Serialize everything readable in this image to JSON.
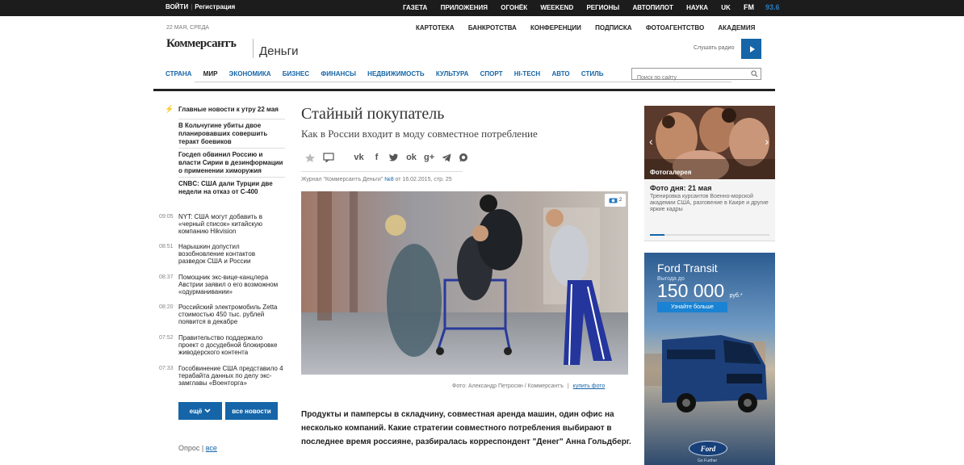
{
  "topbar": {
    "login": "ВОЙТИ",
    "register": "Регистрация",
    "links": [
      "ГАЗЕТА",
      "ПРИЛОЖЕНИЯ",
      "ОГОНЁК",
      "WEEKEND",
      "РЕГИОНЫ",
      "АВТОПИЛОТ",
      "НАУКА",
      "UK"
    ],
    "fm": "FM",
    "fm_freq": "93.6"
  },
  "header": {
    "date": "22 МАЯ, СРЕДА",
    "secondary_nav": [
      "КАРТОТЕКА",
      "БАНКРОТСТВА",
      "КОНФЕРЕНЦИИ",
      "ПОДПИСКА",
      "ФОТОАГЕНТСТВО",
      "АКАДЕМИЯ"
    ],
    "logo": "Коммерсантъ",
    "section": "Деньги",
    "radio_label": "Слушать радио"
  },
  "main_nav": {
    "items": [
      "СТРАНА",
      "МИР",
      "ЭКОНОМИКА",
      "БИЗНЕС",
      "ФИНАНСЫ",
      "НЕДВИЖИМОСТЬ",
      "КУЛЬТУРА",
      "СПОРТ",
      "HI-TECH",
      "АВТО",
      "СТИЛЬ"
    ],
    "active": "МИР",
    "search_placeholder": "Поиск по сайту"
  },
  "left": {
    "lead_heading": "Главные новости к утру 22 мая",
    "lead_items": [
      "В Кольчугине убиты двое планировавших совершить теракт боевиков",
      "Госдеп обвинил Россию и власти Сирии в дезинформации о применении химоружия",
      "CNBC: США дали Турции две недели на отказ от С-400"
    ],
    "news": [
      {
        "time": "09:05",
        "text": "NYT: США могут добавить в «черный список» китайскую компанию Hikvision"
      },
      {
        "time": "08:51",
        "text": "Нарышкин допустил возобновление контактов разведок США и России"
      },
      {
        "time": "08:37",
        "text": "Помощник экс-вице-канцлера Австрии заявил о его возможном «одурманивании»"
      },
      {
        "time": "08:20",
        "text": "Российский электромобиль Zetta стоимостью 450 тыс. рублей появится в декабре"
      },
      {
        "time": "07:52",
        "text": "Правительство поддержало проект о досудебной блокировке живодерского контента"
      },
      {
        "time": "07:33",
        "text": "Гособвинение США представило 4 терабайта данных по делу экс-замглавы «Военторга»"
      }
    ],
    "more_button": "ещё",
    "all_news_button": "все новости",
    "poll_label": "Опрос",
    "poll_all": "все"
  },
  "article": {
    "title": "Стайный покупатель",
    "subtitle": "Как в России входит в моду совместное потребление",
    "source_prefix": "Журнал \"Коммерсантъ Деньги\"",
    "source_issue": "№8",
    "source_suffix": "от 16.02.2015, стр. 25",
    "photo_count": "2",
    "photo_credit": "Фото: Александр Петросян / Коммерсантъ",
    "buy_photo": "купить фото",
    "lead": "Продукты и памперсы в складчину, совместная аренда машин, один офис на несколько компаний. Какие стратегии совместного потребления выбирают в последнее время россияне, разбиралась корреспондент \"Денег\" Анна Гольдберг."
  },
  "gallery": {
    "label": "Фотогалерея",
    "title": "Фото дня: 21 мая",
    "text": "Тренировка курсантов Военно-морской академии США, разговение в Каире и другие яркие кадры",
    "progress": 0.12
  },
  "ad": {
    "title": "Ford Transit",
    "note": "Выгода до",
    "price": "150 000",
    "currency": "руб.*",
    "button": "Узнайте больше",
    "logo": "Ford",
    "slogan": "Go Further"
  }
}
